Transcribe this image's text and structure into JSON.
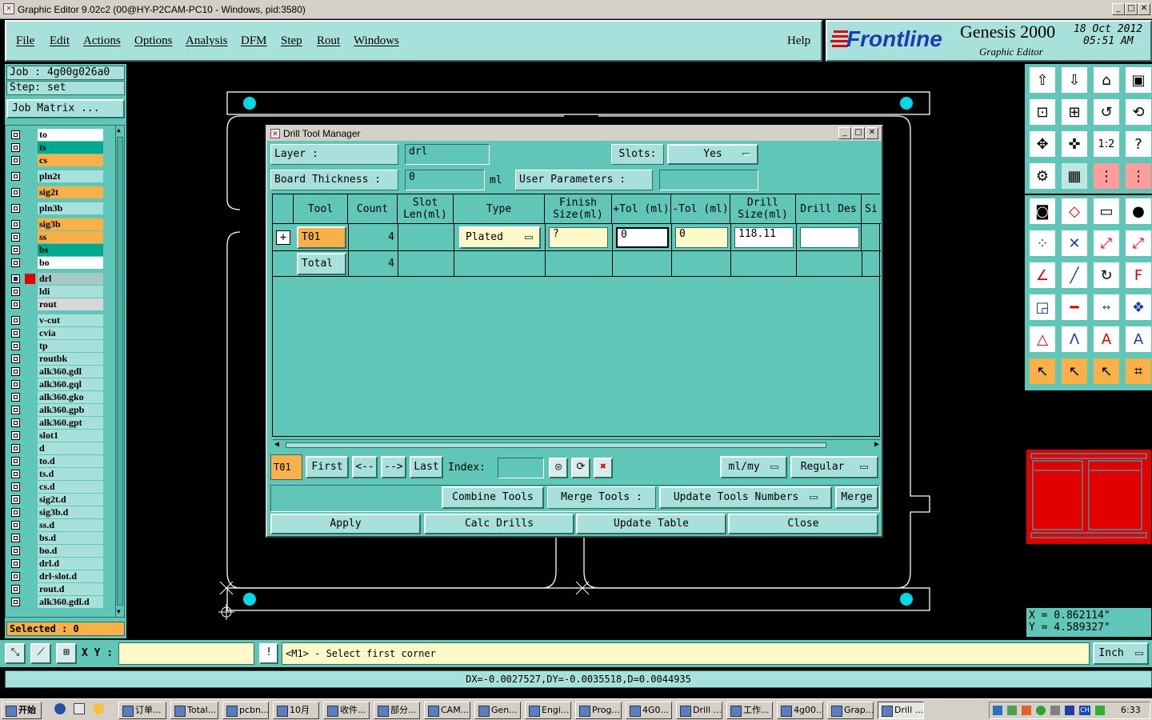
{
  "window": {
    "title": "Graphic Editor 9.02c2 (00@HY-P2CAM-PC10 - Windows, pid:3580)"
  },
  "menu": [
    "File",
    "Edit",
    "Actions",
    "Options",
    "Analysis",
    "DFM",
    "Step",
    "Rout",
    "Windows"
  ],
  "help": "Help",
  "logo": {
    "brand": "Frontline",
    "product": "Genesis 2000",
    "subtitle": "Graphic Editor",
    "date": "18 Oct 2012",
    "time": "05:51 AM"
  },
  "job": {
    "job_label": "Job : 4g00g026a0",
    "step_label": "Step: set",
    "matrix_button": "Job Matrix ..."
  },
  "layers": [
    {
      "name": "to",
      "color": "#ffffff"
    },
    {
      "name": "ts",
      "color": "#00a890"
    },
    {
      "name": "cs",
      "color": "#f8b048"
    },
    {
      "name": "pln2t",
      "color": "#a8e0dc"
    },
    {
      "name": "sig2t",
      "color": "#f8b048"
    },
    {
      "name": "pln3b",
      "color": "#a8e0dc"
    },
    {
      "name": "sig3b",
      "color": "#f8b048"
    },
    {
      "name": "ss",
      "color": "#f8b048"
    },
    {
      "name": "bs",
      "color": "#00a890"
    },
    {
      "name": "bo",
      "color": "#ffffff"
    },
    {
      "name": "drl",
      "color": "#a8c8c8"
    },
    {
      "name": "ldi",
      "color": "#a8e0dc"
    },
    {
      "name": "rout",
      "color": "#d8d8d8"
    },
    {
      "name": "v-cut",
      "color": "#a8e0dc"
    },
    {
      "name": "cvia",
      "color": "#a8e0dc"
    },
    {
      "name": "tp",
      "color": "#a8e0dc"
    },
    {
      "name": "routbk",
      "color": "#a8e0dc"
    },
    {
      "name": "alk360.gdl",
      "color": "#a8e0dc"
    },
    {
      "name": "alk360.gql",
      "color": "#a8e0dc"
    },
    {
      "name": "alk360.gko",
      "color": "#a8e0dc"
    },
    {
      "name": "alk360.gpb",
      "color": "#a8e0dc"
    },
    {
      "name": "alk360.gpt",
      "color": "#a8e0dc"
    },
    {
      "name": "slot1",
      "color": "#a8e0dc"
    },
    {
      "name": "d",
      "color": "#a8e0dc"
    },
    {
      "name": "to.d",
      "color": "#a8e0dc"
    },
    {
      "name": "ts.d",
      "color": "#a8e0dc"
    },
    {
      "name": "cs.d",
      "color": "#a8e0dc"
    },
    {
      "name": "sig2t.d",
      "color": "#a8e0dc"
    },
    {
      "name": "sig3b.d",
      "color": "#a8e0dc"
    },
    {
      "name": "ss.d",
      "color": "#a8e0dc"
    },
    {
      "name": "bs.d",
      "color": "#a8e0dc"
    },
    {
      "name": "bo.d",
      "color": "#a8e0dc"
    },
    {
      "name": "drl.d",
      "color": "#a8e0dc"
    },
    {
      "name": "drl-slot.d",
      "color": "#a8e0dc"
    },
    {
      "name": "rout.d",
      "color": "#a8e0dc"
    },
    {
      "name": "alk360.gdl.d",
      "color": "#a8e0dc"
    }
  ],
  "selected": "Selected : 0",
  "dialog": {
    "title": "Drill Tool Manager",
    "layer_label": "Layer :",
    "layer_value": "drl",
    "slots_label": "Slots:",
    "slots_value": "Yes",
    "board_thickness_label": "Board Thickness :",
    "board_thickness_value": "0",
    "board_thickness_unit": "ml",
    "user_params_label": "User Parameters :",
    "user_params_value": "",
    "headers": [
      "Tool",
      "Count",
      "Slot Len(ml)",
      "Type",
      "Finish Size(ml)",
      "+Tol (ml)",
      "-Tol (ml)",
      "Drill Size(ml)",
      "Drill Des",
      "Si"
    ],
    "rows": [
      {
        "tool": "T01",
        "count": "4",
        "type": "Plated",
        "finish": "?",
        "ptol": "0",
        "ntol": "0",
        "drill": "118.11",
        "des": ""
      }
    ],
    "total": {
      "label": "Total",
      "count": "4"
    },
    "nav": {
      "current": "T01",
      "first": "First",
      "prev": "<--",
      "next": "-->",
      "last": "Last",
      "index_label": "Index:",
      "units": "ml/my",
      "mode": "Regular"
    },
    "tools": {
      "combine": "Combine Tools",
      "merge_label": "Merge Tools :",
      "update_numbers": "Update Tools Numbers",
      "merge": "Merge"
    },
    "actions": [
      "Apply",
      "Calc Drills",
      "Update Table",
      "Close"
    ]
  },
  "coords": {
    "x": "X = 0.862114\"",
    "y": "Y = 4.589327\""
  },
  "bottom": {
    "xy_label": "X Y :",
    "xy_value": "",
    "prompt": "<M1> - Select first corner",
    "unit": "Inch"
  },
  "status": "DX=-0.0027527,DY=-0.0035518,D=0.0044935",
  "taskbar": {
    "start": "开始",
    "tasks": [
      "订单...",
      "Total...",
      "pcbn...",
      "10月",
      "收件...",
      "部分...",
      "CAM...",
      "Gen...",
      "Engi...",
      "Prog...",
      "4G0...",
      "Drill ...",
      "工作...",
      "4g00...",
      "Grap...",
      "Drill ..."
    ],
    "clock": "6:33"
  },
  "colors": {
    "panel": "#5fc6b8",
    "light": "#a8e0dc",
    "accent_red": "#e00000",
    "cyan_dot": "#00d8e8"
  }
}
